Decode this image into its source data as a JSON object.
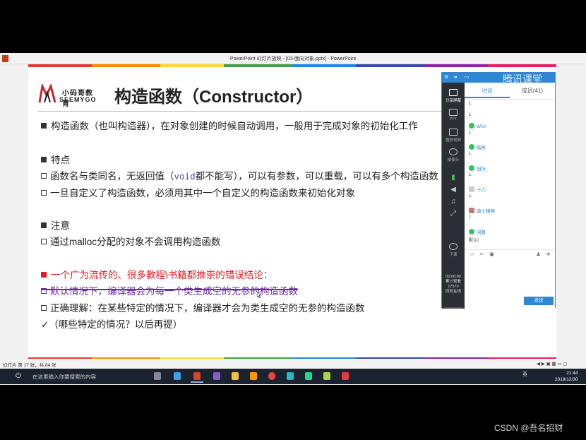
{
  "window": {
    "title": "PowerPoint 幻灯片放映 - [03-面向对象.pptx] - PowerPoint",
    "status_left": "幻灯片 第 17 张，共 84 张",
    "zoom_buttons": "◀ ▶ ▣ ▦ ▭ ▢"
  },
  "slide": {
    "brand_cn": "小码哥教育",
    "brand_en": "SEEMYGO",
    "title": "构造函数（Constructor）",
    "line1": "构造函数（也叫构造器），在对象创建的时候自动调用，一般用于完成对象的初始化工作",
    "section1": "特点",
    "point1_a": "函数名与类同名，无返回值（",
    "point1_code": "void",
    "point1_b": "都不能写），可以有参数，可以重载，可以有多个构造函数",
    "point2": "一旦自定义了构造函数，必须用其中一个自定义的构造函数来初始化对象",
    "section2": "注意",
    "point3": "通过malloc分配的对象不会调用构造函数",
    "section3": "一个广为流传的、很多教程\\书籍都推崇的错误结论：",
    "point4": "默认情况下，编译器会为每一个类生成空的无参的构造函数",
    "point5": "正确理解：在某些特定的情况下，编译器才会为类生成空的无参的构造函数",
    "point6": "✓（哪些特定的情况？以后再提）"
  },
  "tencent": {
    "brand": "腾讯课堂",
    "side": {
      "share": "分享屏幕",
      "ppt": "PPT",
      "video": "播放视频",
      "camera": "摄像头",
      "exit": "下课",
      "time": "00:00:00",
      "stats1": "累计观看",
      "stats2": "17570",
      "stats3": "同时在线"
    },
    "tabs": {
      "discuss": "讨论",
      "members": "成员(41)"
    },
    "messages": [
      {
        "user": "",
        "text": "1"
      },
      {
        "user": "",
        "text": "1"
      },
      {
        "user": "WUn",
        "text": "1"
      },
      {
        "user": "临彬",
        "text": "1"
      },
      {
        "user": "旧行",
        "text": "1"
      },
      {
        "user": "十六",
        "text": "1"
      },
      {
        "user": "骑士精神",
        "text": "1"
      },
      {
        "user": "闲葛",
        "text": "默认）"
      }
    ],
    "send": "发送"
  },
  "taskbar": {
    "search_placeholder": "在这里输入你要搜索的内容",
    "tray_lang": "英",
    "time": "21:44",
    "date": "2018/12/30"
  },
  "watermark": "CSDN @吾名招财"
}
